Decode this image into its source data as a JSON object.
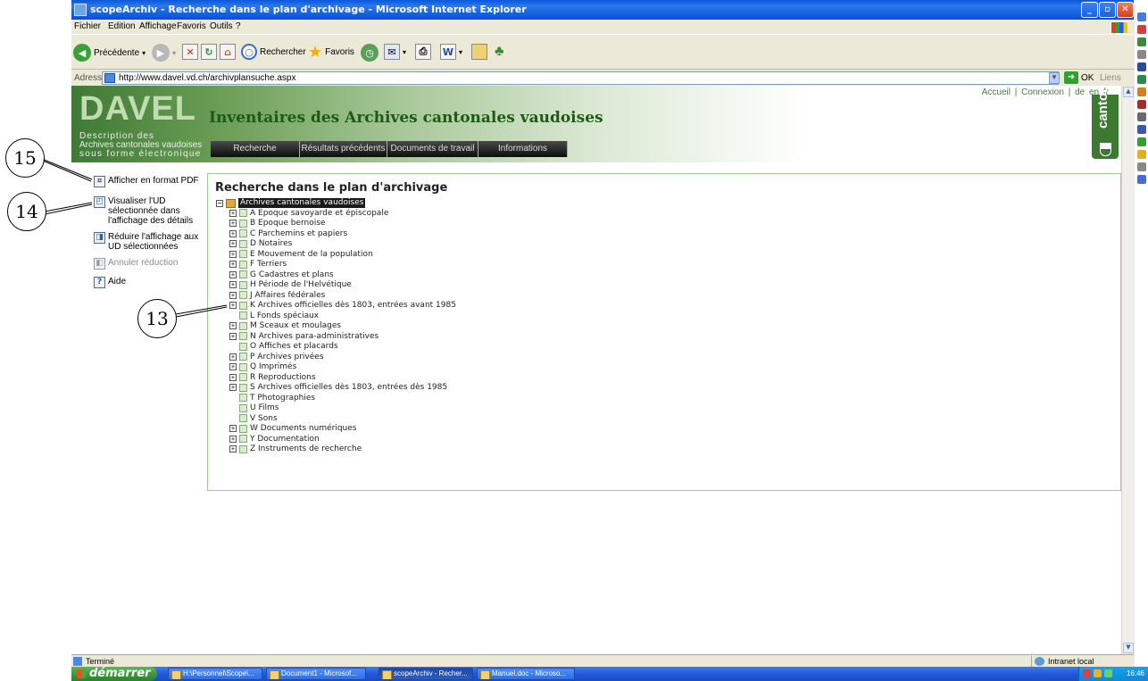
{
  "window": {
    "title": "scopeArchiv - Recherche dans le plan d'archivage - Microsoft Internet Explorer"
  },
  "menu": [
    "Fichier",
    "Edition",
    "Affichage",
    "Favoris",
    "Outils",
    "?"
  ],
  "toolbar": {
    "back": "Précédente",
    "search": "Rechercher",
    "favorites": "Favoris"
  },
  "address": {
    "label": "Adresse",
    "url": "http://www.davel.vd.ch/archivplansuche.aspx",
    "go": "OK",
    "links": "Liens"
  },
  "banner": {
    "logo": "DAVEL",
    "subtitle_lines": [
      "Description des",
      "Archives cantonales vaudoises",
      "sous forme électronique"
    ],
    "title": "Inventaires des Archives cantonales vaudoises",
    "top_links": "Accueil  |   Connexion  |  de  en  fr",
    "canton": "canton de vaud"
  },
  "nav": [
    {
      "label": "Recherche"
    },
    {
      "label": "Résultats précédents"
    },
    {
      "label": "Documents de travail"
    },
    {
      "label": "Informations"
    }
  ],
  "sidemenu": {
    "pdf": "Afficher en format PDF",
    "visualize": [
      "Visualiser l'UD",
      "sélectionnée dans",
      "l'affichage des détails"
    ],
    "reduce": [
      "Réduire l'affichage aux",
      "UD sélectionnées"
    ],
    "cancel": "Annuler réduction",
    "help": "Aide"
  },
  "panel": {
    "title": "Recherche dans le plan d'archivage"
  },
  "tree": {
    "root": "Archives cantonales vaudoises",
    "items": [
      {
        "label": "A Epoque savoyarde et épiscopale",
        "expandable": true
      },
      {
        "label": "B Epoque bernoise",
        "expandable": true
      },
      {
        "label": "C Parchemins et papiers",
        "expandable": true
      },
      {
        "label": "D Notaires",
        "expandable": true
      },
      {
        "label": "E Mouvement de la population",
        "expandable": true
      },
      {
        "label": "F Terriers",
        "expandable": true
      },
      {
        "label": "G Cadastres et plans",
        "expandable": true
      },
      {
        "label": "H Période de l'Helvétique",
        "expandable": true
      },
      {
        "label": "J Affaires fédérales",
        "expandable": true
      },
      {
        "label": "K Archives officielles dès 1803, entrées avant 1985",
        "expandable": true
      },
      {
        "label": "L Fonds spéciaux",
        "expandable": false
      },
      {
        "label": "M Sceaux et moulages",
        "expandable": true
      },
      {
        "label": "N Archives para-administratives",
        "expandable": true
      },
      {
        "label": "O Affiches et placards",
        "expandable": false
      },
      {
        "label": "P Archives privées",
        "expandable": true
      },
      {
        "label": "Q Imprimés",
        "expandable": true
      },
      {
        "label": "R Reproductions",
        "expandable": true
      },
      {
        "label": "S Archives officielles dès 1803, entrées dès 1985",
        "expandable": true
      },
      {
        "label": "T Photographies",
        "expandable": false
      },
      {
        "label": "U Films",
        "expandable": false
      },
      {
        "label": "V Sons",
        "expandable": false
      },
      {
        "label": "W Documents numériques",
        "expandable": true
      },
      {
        "label": "Y Documentation",
        "expandable": true
      },
      {
        "label": "Z Instruments de recherche",
        "expandable": true
      }
    ]
  },
  "callouts": {
    "c15": "15",
    "c14": "14",
    "c13": "13"
  },
  "status": {
    "left": "Terminé",
    "zone": "Intranet local"
  },
  "taskbar": {
    "start": "démarrer",
    "tasks": [
      "H:\\Personnel\\Scope\\...",
      "Document1 - Microsof...",
      "scopeArchiv - Recher...",
      "Manuel.doc - Microso..."
    ],
    "clock": "16:46"
  }
}
